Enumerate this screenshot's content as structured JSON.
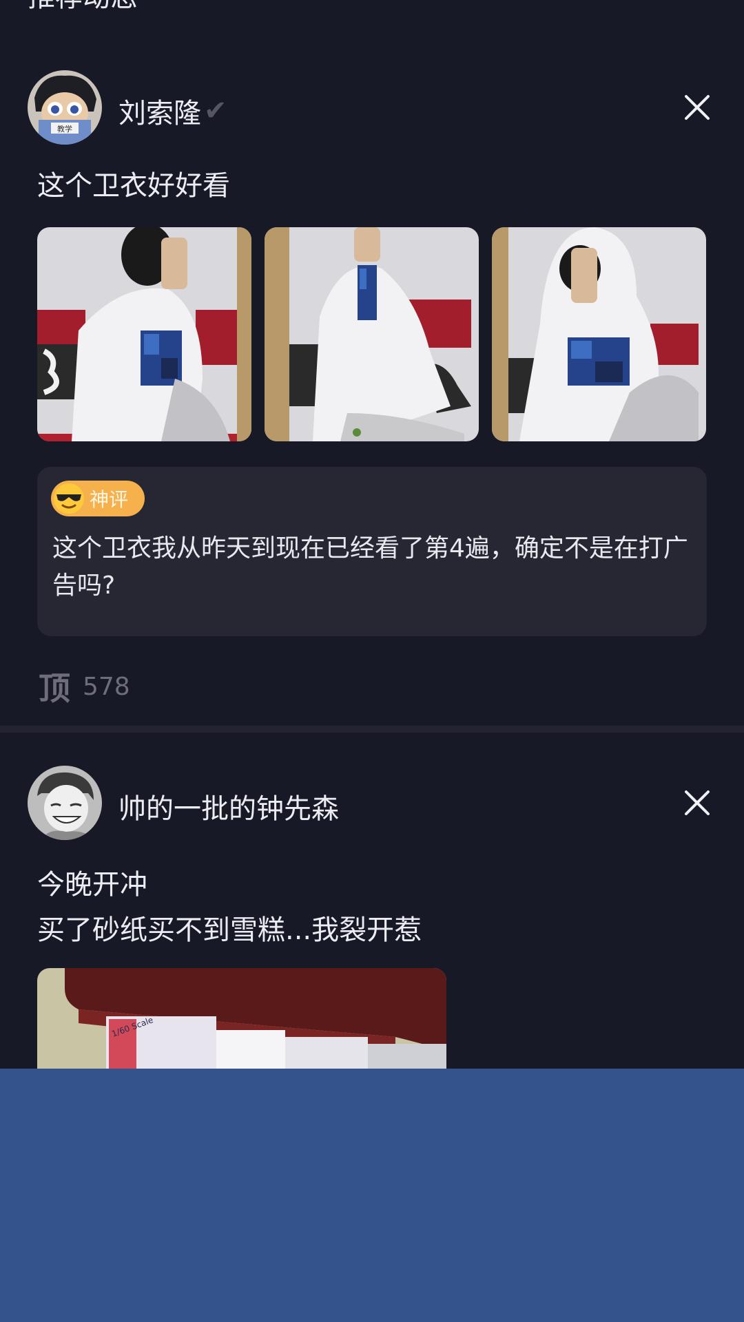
{
  "section": {
    "title": "推荐动态"
  },
  "posts": [
    {
      "username": "刘索隆",
      "verified_icon": "check-icon",
      "text_lines": [
        "这个卫衣好好看"
      ],
      "images": [
        "hoodie-photo-1",
        "hoodie-photo-2",
        "hoodie-photo-3"
      ],
      "god_comment": {
        "badge_emoji": "sunglasses-emoji",
        "badge_label": "神评",
        "text": "这个卫衣我从昨天到现在已经看了第4遍，确定不是在打广告吗?"
      },
      "like": {
        "icon_label": "顶",
        "count": "578"
      }
    },
    {
      "username": "帅的一批的钟先森",
      "text_lines": [
        "今晚开冲",
        "买了砂纸买不到雪糕...我裂开惹"
      ],
      "images": [
        "model-kit-photo"
      ]
    }
  ],
  "colors": {
    "background": "#181926",
    "card": "#262733",
    "badge": "#f6b14c",
    "overlay": "#34528b",
    "muted": "#6d6e79"
  }
}
